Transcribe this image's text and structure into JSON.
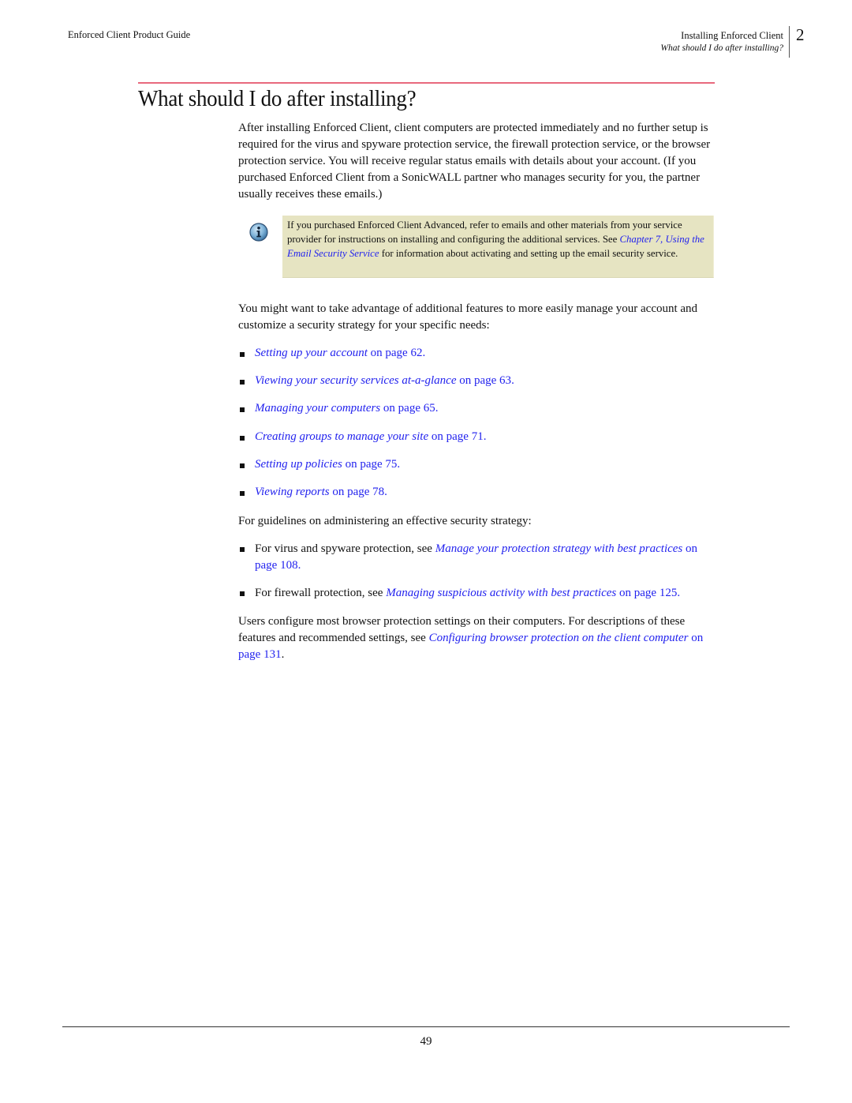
{
  "header": {
    "book_title": "Enforced Client Product Guide",
    "chapter_title": "Installing Enforced Client",
    "section_title": "What should I do after installing?",
    "chapter_number": "2"
  },
  "title": "What should I do after installing?",
  "intro_paragraph": "After installing Enforced Client, client computers are protected immediately and no further setup is required for the virus and spyware protection service, the firewall protection service, or the browser protection service. You will receive regular status emails with details about your account. (If you purchased Enforced Client from a SonicWALL partner who manages security for you, the partner usually receives these emails.)",
  "note": {
    "icon": "info-icon",
    "text_before": "If you purchased Enforced Client Advanced, refer to emails and other materials from your service provider for instructions on installing and configuring the additional services. See ",
    "link": "Chapter 7, Using the Email Security Service",
    "text_after": " for information about activating and setting up the email security service."
  },
  "features_intro": "You might want to take advantage of additional features to more easily manage your account and customize a security strategy for your specific needs:",
  "feature_links": [
    {
      "title": "Setting up your account",
      "page_ref": " on page 62",
      "end": "."
    },
    {
      "title": "Viewing your security services at-a-glance",
      "page_ref": " on page 63",
      "end": "."
    },
    {
      "title": "Managing your computers",
      "page_ref": " on page 65",
      "end": "."
    },
    {
      "title": "Creating groups to manage your site",
      "page_ref": " on page 71",
      "end": "."
    },
    {
      "title": "Setting up policies",
      "page_ref": " on page 75",
      "end": "."
    },
    {
      "title": "Viewing reports",
      "page_ref": " on page 78",
      "end": "."
    }
  ],
  "guidelines_intro": "For guidelines on administering an effective security strategy:",
  "guidelines": [
    {
      "prefix": "For virus and spyware protection, see ",
      "title": "Manage your protection strategy with best practices",
      "page_ref": " on page 108",
      "end": "."
    },
    {
      "prefix": "For firewall protection, see ",
      "title": "Managing suspicious activity with best practices",
      "page_ref": " on page 125",
      "end": "."
    }
  ],
  "closing": {
    "text_before": "Users configure most browser protection settings on their computers. For descriptions of these features and recommended settings, see ",
    "link_title": "Configuring browser protection on the client computer",
    "page_ref": " on page 131",
    "end": "."
  },
  "footer": {
    "page_number": "49"
  },
  "colors": {
    "link": "#2222ee",
    "title_rule": "#e8697d",
    "note_background": "#e6e4c2"
  }
}
